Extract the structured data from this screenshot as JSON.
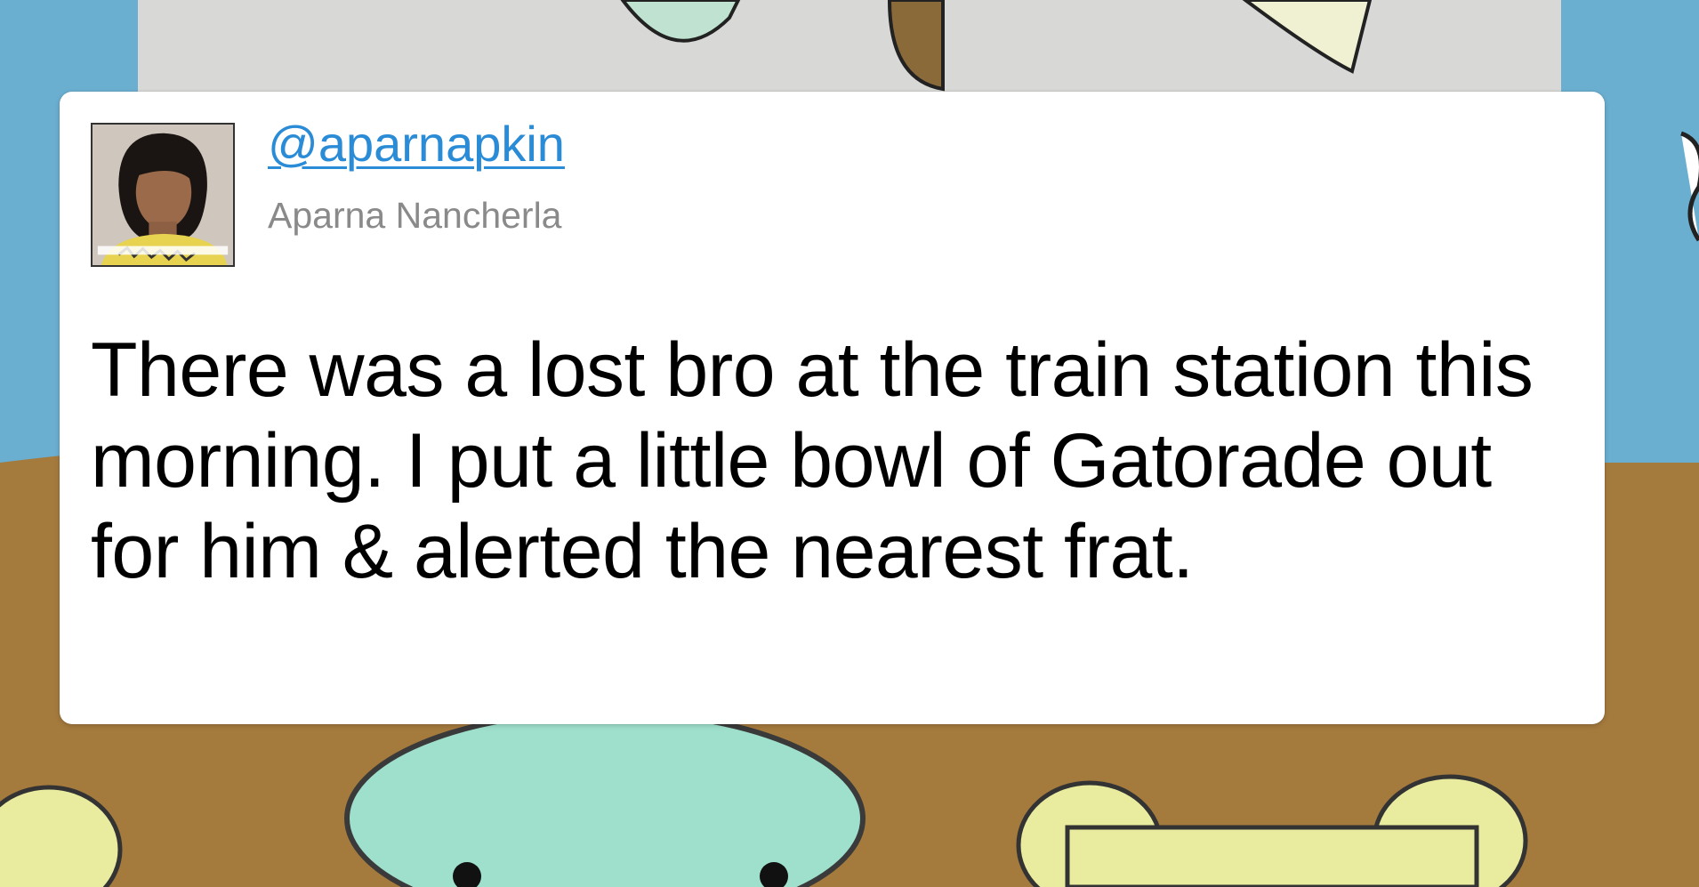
{
  "tweet": {
    "handle": "@aparnapkin",
    "display_name": "Aparna Nancherla",
    "text": "There was a lost bro at the train station this morning. I put a little bowl of Gatorade out for him & alerted the nearest frat."
  },
  "colors": {
    "handle_link": "#2a8bd6",
    "display_name": "#8a8a8a",
    "card_background": "#ffffff",
    "page_background_sky": "#6aaed0",
    "page_background_ground": "#a47a3d"
  },
  "icons": {
    "avatar": "profile-photo"
  }
}
